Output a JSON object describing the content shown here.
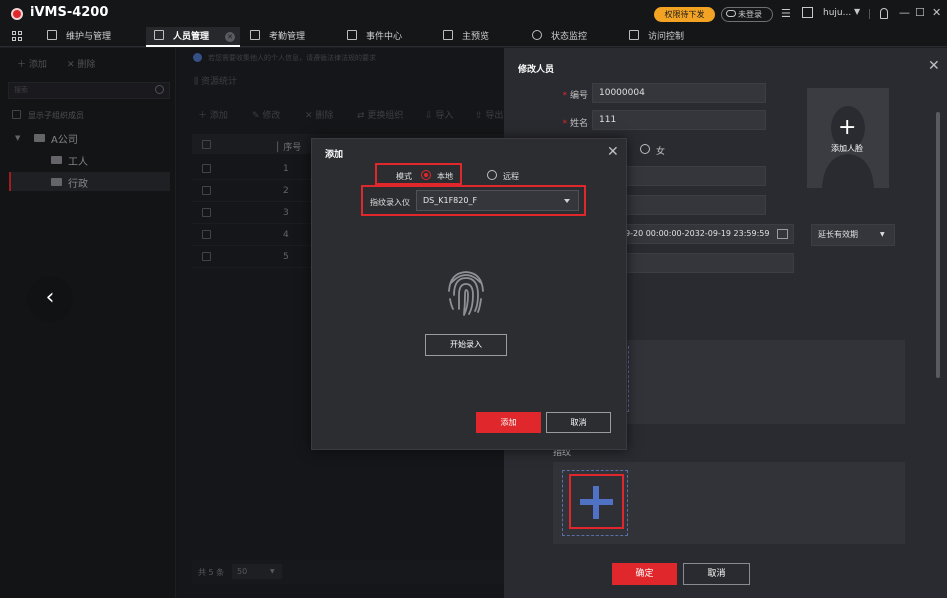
{
  "app": {
    "title": "iVMS-4200",
    "pending_badge": "权限待下发",
    "login_status": "未登录",
    "user_name": "huju...",
    "window_controls": {
      "lock": "lock-icon",
      "minimize": "—",
      "maximize": "☐",
      "close": "✕"
    }
  },
  "nav": {
    "tabs": [
      {
        "label": "维护与管理",
        "icon": "maintenance-icon"
      },
      {
        "label": "人员管理",
        "icon": "person-management-icon",
        "active": true
      },
      {
        "label": "考勤管理",
        "icon": "attendance-icon"
      },
      {
        "label": "事件中心",
        "icon": "event-center-icon"
      },
      {
        "label": "主预览",
        "icon": "main-view-icon"
      },
      {
        "label": "状态监控",
        "icon": "status-monitor-icon"
      },
      {
        "label": "访问控制",
        "icon": "access-control-icon"
      }
    ]
  },
  "left_panel": {
    "add": "添加",
    "delete": "删除",
    "search_placeholder": "搜索",
    "show_sub_members": "显示子组织成员",
    "tree": {
      "root": "A公司",
      "children": [
        "工人",
        "行政"
      ],
      "selected": "行政"
    }
  },
  "main": {
    "notice": "若您需要收集他人的个人信息，请遵循法律法规的要求",
    "resource_stats": "资源统计",
    "toolbar": [
      "添加",
      "修改",
      "删除",
      "更换组织",
      "导入",
      "导出"
    ],
    "table": {
      "header_seq": "序号",
      "rows": [
        "1",
        "2",
        "3",
        "4",
        "5"
      ]
    },
    "pager": {
      "total": "共 5 条",
      "page_size": "50"
    }
  },
  "edit_panel": {
    "title": "修改人员",
    "fields": {
      "id_label": "编号",
      "id_value": "10000004",
      "name_label": "姓名",
      "name_value": "111",
      "gender_female": "女",
      "validity_range": "9-20 00:00:00-2032-09-19 23:59:59",
      "extend_validity": "延长有效期"
    },
    "face_label": "添加人脸",
    "fingerprint_label": "指纹",
    "ok": "确定",
    "cancel": "取消"
  },
  "dialog": {
    "title": "添加",
    "mode_label": "模式",
    "mode_local": "本地",
    "mode_remote": "远程",
    "device_label": "指纹录入仪",
    "device_value": "DS_K1F820_F",
    "start_button": "开始录入",
    "add_button": "添加",
    "cancel_button": "取消"
  },
  "colors": {
    "accent_red": "#e0282c",
    "badge_orange": "#f2a324",
    "plus_blue": "#4f72c4"
  }
}
